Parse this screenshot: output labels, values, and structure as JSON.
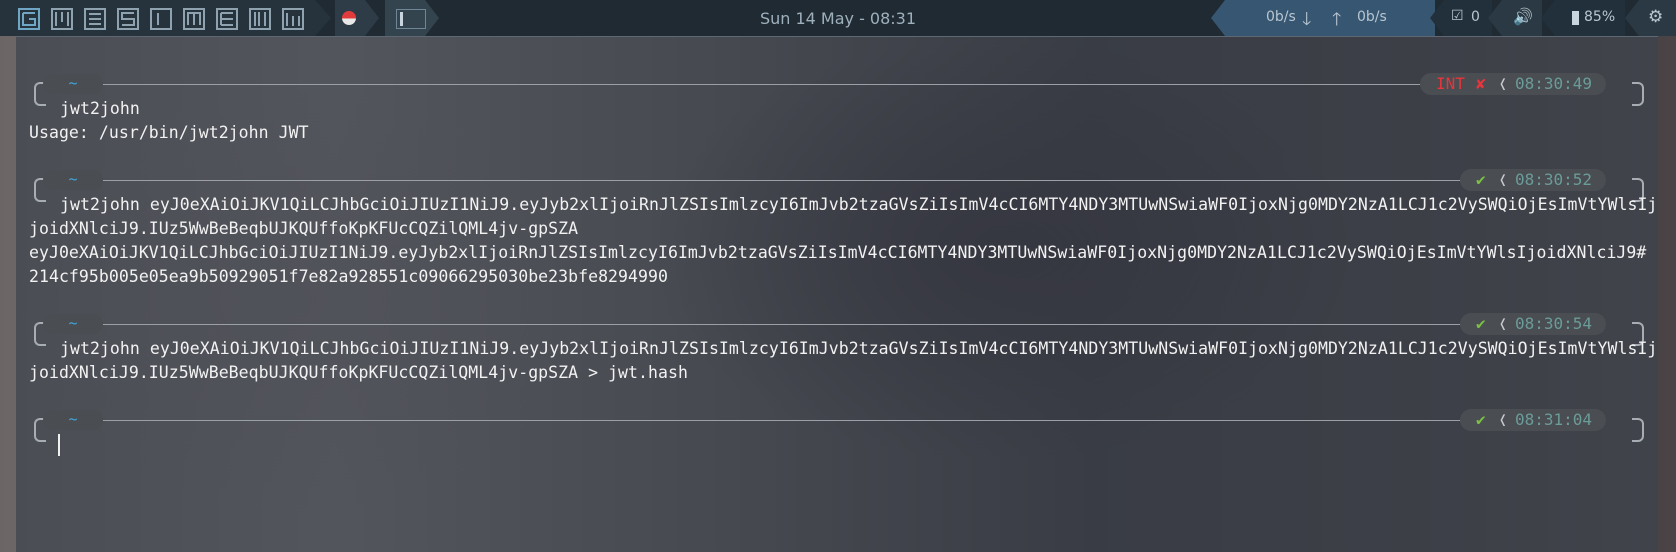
{
  "topbar": {
    "tags": [
      "tag-1",
      "tag-2",
      "tag-3",
      "tag-4",
      "tag-5",
      "tag-6",
      "tag-7",
      "tag-8",
      "tag-9"
    ],
    "clock": "Sun 14 May - 08:31",
    "net_down": "0b/s",
    "net_up": "0b/s",
    "updates": "0",
    "battery": "85%"
  },
  "terminal": {
    "prompts": [
      {
        "dir": "~",
        "status_text": "INT",
        "status_icon": "✘",
        "time": "08:30:49",
        "state": "error"
      },
      {
        "dir": "~",
        "status_icon": "✔",
        "time": "08:30:52",
        "state": "ok"
      },
      {
        "dir": "~",
        "status_icon": "✔",
        "time": "08:30:54",
        "state": "ok"
      },
      {
        "dir": "~",
        "status_icon": "✔",
        "time": "08:31:04",
        "state": "ok"
      }
    ],
    "lines": [
      "jwt2john",
      "Usage: /usr/bin/jwt2john JWT",
      "jwt2john eyJ0eXAiOiJKV1QiLCJhbGciOiJIUzI1NiJ9.eyJyb2xlIjoiRnJlZSIsImlzcyI6ImJvb2tzaGVsZiIsImV4cCI6MTY4NDY3MTUwNSwiaWF0IjoxNjg0MDY2NzA1LCJ1c2VySWQiOjEsImVtYWlsIj",
      "joidXNlciJ9.IUz5WwBeBeqbUJKQUffoKpKFUcCQZilQML4jv-gpSZA",
      "eyJ0eXAiOiJKV1QiLCJhbGciOiJIUzI1NiJ9.eyJyb2xlIjoiRnJlZSIsImlzcyI6ImJvb2tzaGVsZiIsImV4cCI6MTY4NDY3MTUwNSwiaWF0IjoxNjg0MDY2NzA1LCJ1c2VySWQiOjEsImVtYWlsIjoidXNlciJ9#",
      "214cf95b005e05ea9b50929051f7e82a928551c09066295030be23bfe8294990",
      "jwt2john eyJ0eXAiOiJKV1QiLCJhbGciOiJIUzI1NiJ9.eyJyb2xlIjoiRnJlZSIsImlzcyI6ImJvb2tzaGVsZiIsImV4cCI6MTY4NDY3MTUwNSwiaWF0IjoxNjg0MDY2NzA1LCJ1c2VySWQiOjEsImVtYWlsIj",
      "joidXNlciJ9.IUz5WwBeBeqbUJKQUffoKpKFUcCQZilQML4jv-gpSZA > jwt.hash"
    ]
  }
}
